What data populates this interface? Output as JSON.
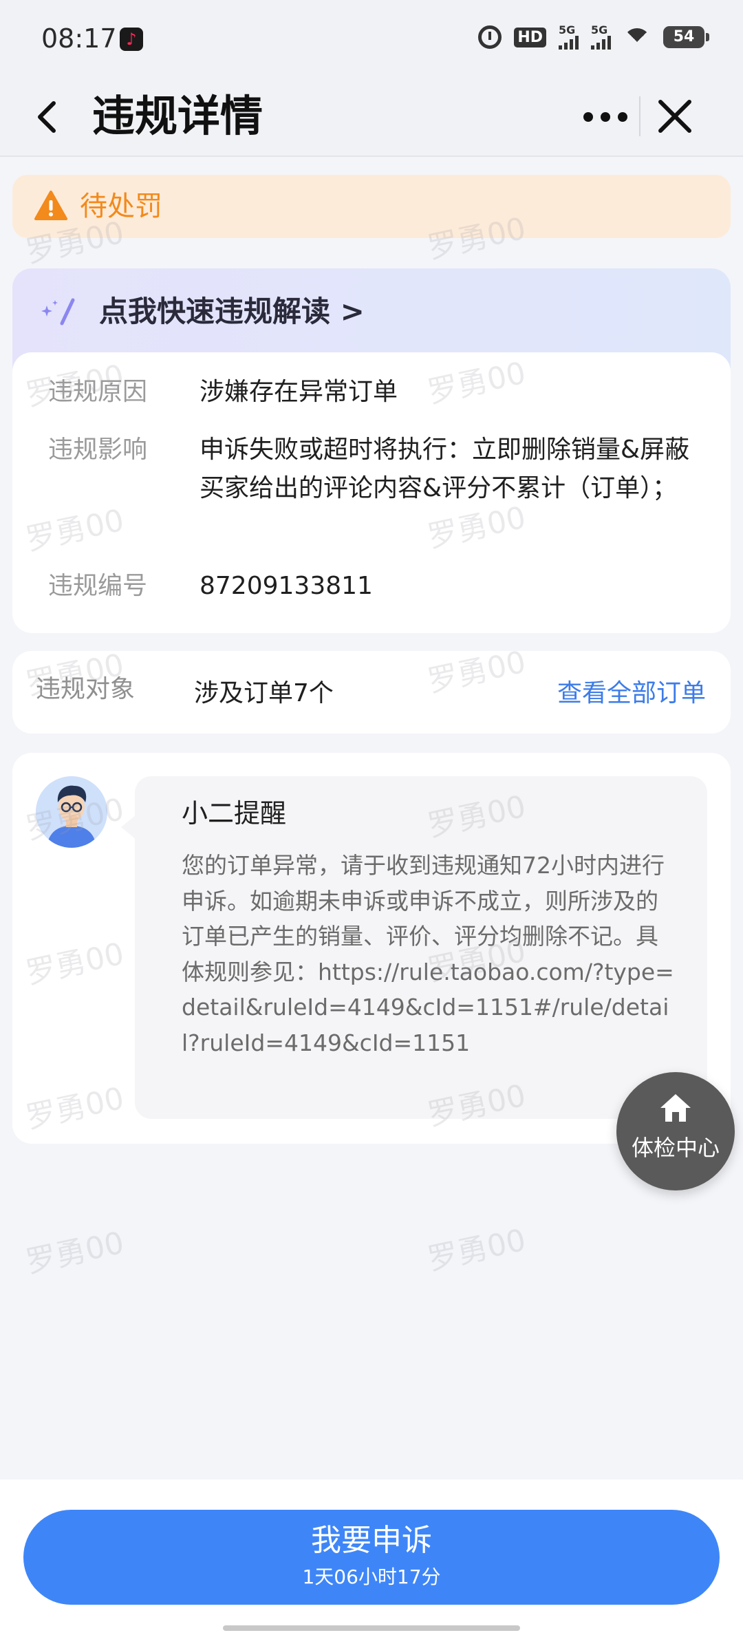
{
  "status_bar": {
    "time": "08:17",
    "hd_label": "HD",
    "signal_1": "5G",
    "signal_2": "5G",
    "battery": "54"
  },
  "nav": {
    "title": "违规详情"
  },
  "penalty": {
    "status": "待处罚",
    "accent_color": "#f28a1c"
  },
  "interpretation": {
    "label": "点我快速违规解读 >"
  },
  "details": [
    {
      "label": "违规原因",
      "value": "涉嫌存在异常订单"
    },
    {
      "label": "违规影响",
      "value": "申诉失败或超时将执行：立即删除销量&屏蔽买家给出的评论内容&评分不累计（订单）；"
    },
    {
      "label": "违规编号",
      "value": "87209133811"
    }
  ],
  "object": {
    "label": "违规对象",
    "value": "涉及订单7个",
    "link": "查看全部订单"
  },
  "reminder": {
    "title": "小二提醒",
    "body": "您的订单异常，请于收到违规通知72小时内进行申诉。如逾期未申诉或申诉不成立，则所涉及的订单已产生的销量、评价、评分均删除不记。具体规则参见：https://rule.taobao.com/?type=detail&ruleId=4149&cId=1151#/rule/detail?ruleId=4149&cId=1151"
  },
  "float_button": {
    "label": "体检中心",
    "icon": "home-icon"
  },
  "watermark": "罗勇00",
  "appeal": {
    "label": "我要申诉",
    "countdown": "1天06小时17分",
    "color": "#3e86f8"
  }
}
